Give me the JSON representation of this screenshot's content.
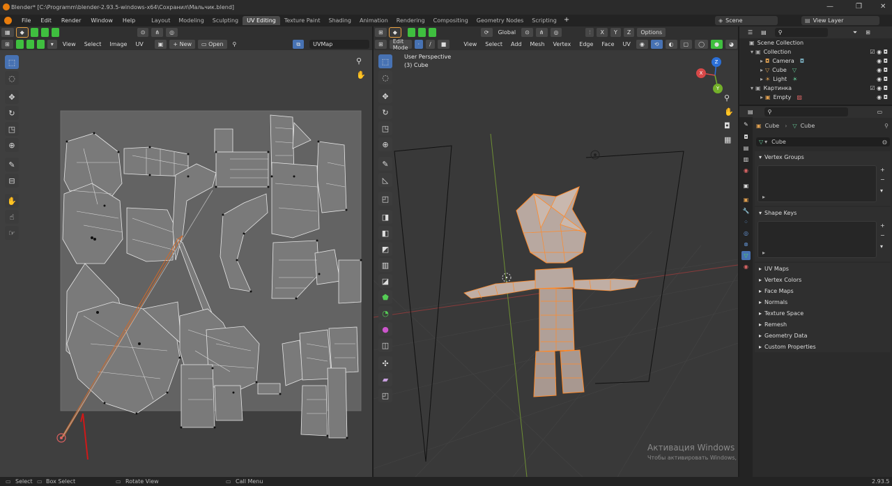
{
  "window": {
    "title": "Blender* [C:\\Programm\\blender-2.93.5-windows-x64\\Сохранил\\Мальчик.blend]"
  },
  "topbar": {
    "menus": [
      "File",
      "Edit",
      "Render",
      "Window",
      "Help"
    ],
    "workspaces": [
      "Layout",
      "Modeling",
      "Sculpting",
      "UV Editing",
      "Texture Paint",
      "Shading",
      "Animation",
      "Rendering",
      "Compositing",
      "Geometry Nodes",
      "Scripting"
    ],
    "active_workspace": "UV Editing",
    "scene": "Scene",
    "view_layer": "View Layer"
  },
  "uv_editor": {
    "menus": [
      "View",
      "Select",
      "Image",
      "UV"
    ],
    "new_label": "New",
    "open_label": "Open",
    "uvmap": "UVMap"
  },
  "viewport": {
    "mode": "Edit Mode",
    "menus": [
      "View",
      "Select",
      "Add",
      "Mesh",
      "Vertex",
      "Edge",
      "Face",
      "UV"
    ],
    "transform_orientation": "Global",
    "options_label": "Options",
    "axis_x": "X",
    "axis_y": "Y",
    "axis_z": "Z",
    "info_line1": "User Perspective",
    "info_line2": "(3) Cube",
    "gizmo": {
      "x": "X",
      "y": "Y",
      "z": "Z"
    }
  },
  "outliner": {
    "root": "Scene Collection",
    "items": [
      {
        "label": "Collection",
        "level": 1,
        "icon_color": "#aaaaaa"
      },
      {
        "label": "Camera",
        "level": 2,
        "icon_color": "#e0a050"
      },
      {
        "label": "Cube",
        "level": 2,
        "icon_color": "#e0a050"
      },
      {
        "label": "Light",
        "level": 2,
        "icon_color": "#e0a050"
      },
      {
        "label": "Картинка",
        "level": 1,
        "icon_color": "#aaaaaa"
      },
      {
        "label": "Empty",
        "level": 2,
        "icon_color": "#e0a050"
      }
    ]
  },
  "properties": {
    "breadcrumb_object": "Cube",
    "breadcrumb_data": "Cube",
    "mesh_name": "Cube",
    "vertex_groups": "Vertex Groups",
    "shape_keys": "Shape Keys",
    "collapsed_panels": [
      "UV Maps",
      "Vertex Colors",
      "Face Maps",
      "Normals",
      "Texture Space",
      "Remesh",
      "Geometry Data",
      "Custom Properties"
    ]
  },
  "watermark": {
    "title": "Активация Windows",
    "subtitle": "Чтобы активировать Windows, перейдите в раздел \"Параметры\"."
  },
  "statusbar": {
    "select": "Select",
    "box_select": "Box Select",
    "rotate_view": "Rotate View",
    "call_menu": "Call Menu",
    "version": "2.93.5"
  },
  "colors": {
    "accent_blue": "#4772b3",
    "selected_orange": "#ff8a2a",
    "active_green": "#3fbf3f"
  }
}
